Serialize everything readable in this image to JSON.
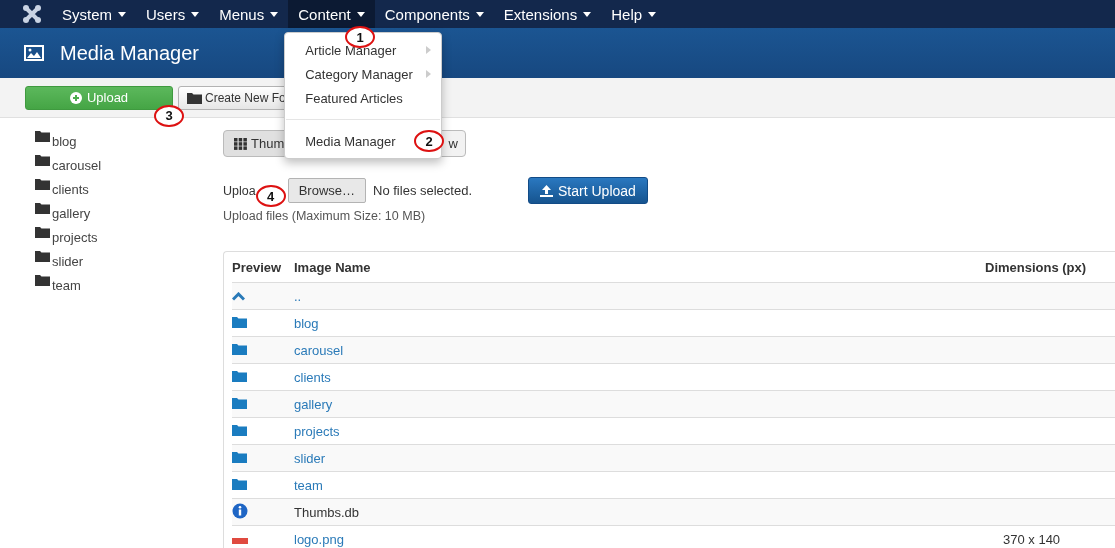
{
  "navbar": {
    "items": [
      {
        "label": "System",
        "selected": false
      },
      {
        "label": "Users",
        "selected": false
      },
      {
        "label": "Menus",
        "selected": false
      },
      {
        "label": "Content",
        "selected": true,
        "annotation": "1"
      },
      {
        "label": "Components",
        "selected": false
      },
      {
        "label": "Extensions",
        "selected": false
      },
      {
        "label": "Help",
        "selected": false
      }
    ]
  },
  "content_menu": {
    "items": [
      {
        "kind": "item",
        "label": "Article Manager",
        "has_submenu": true
      },
      {
        "kind": "item",
        "label": "Category Manager",
        "has_submenu": true
      },
      {
        "kind": "item",
        "label": "Featured Articles",
        "has_submenu": false
      },
      {
        "kind": "divider"
      },
      {
        "kind": "item",
        "label": "Media Manager",
        "has_submenu": false,
        "annotation": "2"
      }
    ]
  },
  "header": {
    "title": "Media Manager"
  },
  "toolbar": {
    "upload": {
      "label": "Upload",
      "annotation": "3"
    },
    "new_folder": {
      "label": "Create New Fo"
    }
  },
  "sidebar": {
    "folders": [
      "blog",
      "carousel",
      "clients",
      "gallery",
      "projects",
      "slider",
      "team"
    ]
  },
  "view_toggle": [
    {
      "label": "Thum",
      "selected": true
    },
    {
      "label": "w",
      "selected": false
    }
  ],
  "upload_form": {
    "label": "Uploa",
    "browse": {
      "label": "Browse…",
      "annotation": "4"
    },
    "status": "No files selected.",
    "start": "Start Upload",
    "hint": "Upload files (Maximum Size: 10 MB)"
  },
  "table": {
    "columns": [
      "Preview",
      "Image Name",
      "Dimensions (px)"
    ],
    "rows": [
      {
        "kind": "up",
        "name": "..",
        "dimensions": ""
      },
      {
        "kind": "folder",
        "name": "blog"
      },
      {
        "kind": "folder",
        "name": "carousel"
      },
      {
        "kind": "folder",
        "name": "clients"
      },
      {
        "kind": "folder",
        "name": "gallery"
      },
      {
        "kind": "folder",
        "name": "projects"
      },
      {
        "kind": "folder",
        "name": "slider"
      },
      {
        "kind": "folder",
        "name": "team"
      },
      {
        "kind": "info",
        "name": "Thumbs.db"
      },
      {
        "kind": "image",
        "name": "logo.png",
        "dimensions": "370 x 140"
      }
    ]
  }
}
